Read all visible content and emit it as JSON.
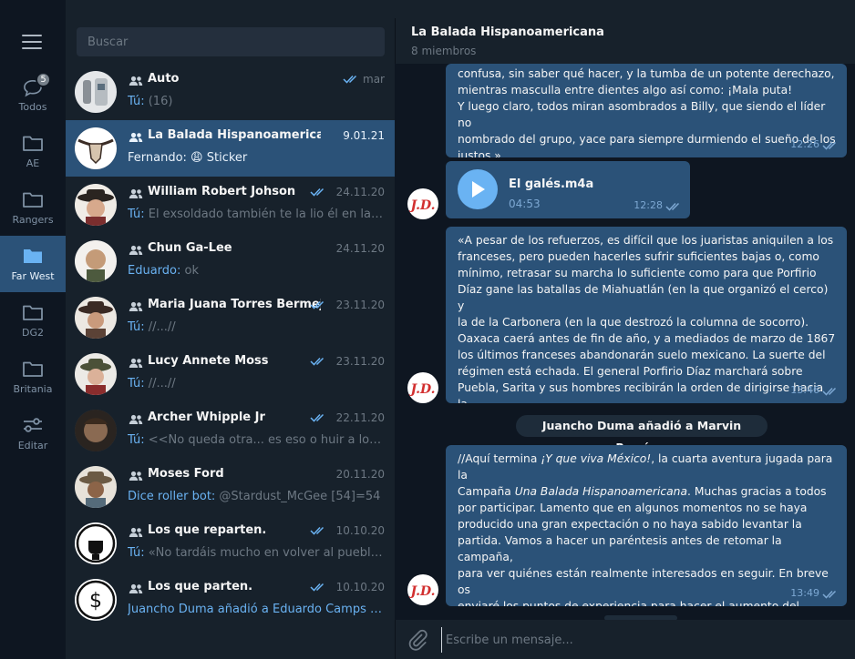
{
  "rail": {
    "menu_icon": "hamburger-icon",
    "folders": [
      {
        "label": "Todos",
        "icon": "chats-icon",
        "badge": "5"
      },
      {
        "label": "AE",
        "icon": "folder-icon"
      },
      {
        "label": "Rangers",
        "icon": "folder-icon"
      },
      {
        "label": "Far West",
        "icon": "folder-icon",
        "active": true
      },
      {
        "label": "DG2",
        "icon": "folder-icon"
      },
      {
        "label": "Britania",
        "icon": "folder-icon"
      },
      {
        "label": "Editar",
        "icon": "sliders-icon"
      }
    ]
  },
  "search": {
    "placeholder": "Buscar"
  },
  "chats": [
    {
      "name": "Auto",
      "date": "mar",
      "read": true,
      "who": "Tú:",
      "preview": " (16)"
    },
    {
      "name": "La Balada Hispanoamericana",
      "date": "9.01.21",
      "read": false,
      "who": "Fernando:",
      "preview": " 😩 Sticker",
      "selected": true
    },
    {
      "name": "William Robert Johson",
      "date": "24.11.20",
      "read": true,
      "who": "Tú:",
      "preview": " El exsoldado también te la lio él en la prue..."
    },
    {
      "name": "Chun Ga-Lee",
      "date": "24.11.20",
      "read": false,
      "who": "Eduardo:",
      "preview": " ok"
    },
    {
      "name": "Maria Juana Torres Bermejo",
      "date": "23.11.20",
      "read": true,
      "who": "Tú:",
      "preview": " //...//"
    },
    {
      "name": "Lucy Annete Moss",
      "date": "23.11.20",
      "read": true,
      "who": "Tú:",
      "preview": " //...//"
    },
    {
      "name": "Archer Whipple Jr",
      "date": "22.11.20",
      "read": true,
      "who": "Tú:",
      "preview": " <<No queda otra... es eso o huir a lo loco.>>"
    },
    {
      "name": "Moses Ford",
      "date": "20.11.20",
      "read": false,
      "who": "Dice roller bot:",
      "preview": " @Stardust_McGee [54]=54"
    },
    {
      "name": "Los que reparten.",
      "date": "10.10.20",
      "read": true,
      "who": "Tú:",
      "preview": " «No tardáis mucho en volver al pueblo co..."
    },
    {
      "name": "Los que parten.",
      "date": "10.10.20",
      "read": true,
      "who": "",
      "preview": "Juancho Duma añadió a Eduardo Camps y Ma...",
      "service": true
    }
  ],
  "chat": {
    "title": "La Balada Hispanoamericana",
    "subtitle": "8 miembros",
    "messages": [
      {
        "text": "confusa, sin saber qué hacer, y la tumba de un potente derechazo,\nmientras masculla entre dientes algo así como: ¡Mala puta!\nY luego claro, todos miran asombrados a Billy, que siendo el líder no\nnombrado del grupo, yace para siempre durmiendo el sueño de los\njustos.»",
        "time": "12:26"
      },
      {
        "audio_name": "El galés.m4a",
        "duration": "04:53",
        "time": "12:28"
      },
      {
        "text": "«A pesar de los refuerzos, es difícil que los juaristas aniquilen a los\nfranceses, pero pueden hacerles sufrir suficientes bajas o, como\nmínimo, retrasar su marcha lo suficiente como para que Porfirio\nDíaz gane las batallas de Miahuatlán (en la que organizó el cerco) y\nla de la Carbonera (en la que destrozó la columna de socorro).\nOaxaca caerá antes de fin de año, y a mediados de marzo de 1867\nlos últimos franceses abandonarán suelo mexicano. La suerte del\nrégimen está echada. El general Porfirio Díaz marchará sobre\nPuebla, Sarita y sus hombres recibirán la orden de dirigirse hacia la\nplaza fuerte de Querétaro... Pero eso, es otra historia.»",
        "time": "13:46"
      },
      {
        "service": "Juancho Duma añadió a Marvin Ramírez"
      },
      {
        "text_parts": [
          "//Aquí termina ",
          "¡Y que viva México!",
          ", la cuarta aventura jugada para la\nCampaña ",
          "Una Balada Hispanoamericana",
          ". Muchas gracias a todos\npor participar. Lamento que en algunos momentos no se haya\nproducido una gran expectación o no haya sabido levantar la\npartida. Vamos a hacer un paréntesis antes de retomar la campaña,\npara ver quiénes están realmente interesados en seguir. En breve os\nenviaré los puntos de experiencia para hacer el aumento del\npersonaje. Podéis dejar de rolear.\n¡Gracias!//"
        ],
        "time": "13:49"
      }
    ],
    "sender_initials": "J.D.",
    "composer_placeholder": "Escribe un mensaje..."
  },
  "colors": {
    "accent": "#2b5278",
    "link": "#6ab2f2",
    "bg": "#0e1621",
    "panel": "#17212b"
  }
}
